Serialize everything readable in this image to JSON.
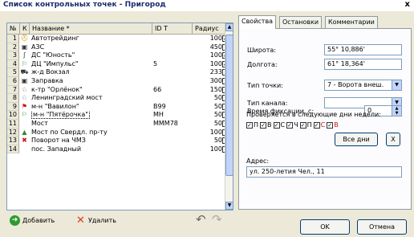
{
  "window": {
    "title": "Список контрольных точек - Пригород",
    "close_glyph": "x"
  },
  "grid": {
    "headers": [
      "№",
      "К",
      "Название *",
      "ID T",
      "Радиус"
    ],
    "rows": [
      {
        "num": "1",
        "icon": "⛑",
        "icon_color": "#cc8800",
        "name": "Автотрейдинг",
        "idt": "",
        "radius": "100",
        "checked": true
      },
      {
        "num": "2",
        "icon": "▣",
        "icon_color": "#333333",
        "name": "АЗС",
        "idt": "",
        "radius": "450",
        "checked": false
      },
      {
        "num": "3",
        "icon": "ʃ",
        "icon_color": "#333333",
        "name": "ДС \"Юность\"",
        "idt": "",
        "radius": "100",
        "checked": true
      },
      {
        "num": "4",
        "icon": "⚐",
        "icon_color": "#2e8b2e",
        "name": "ДЦ \"Импульс\"",
        "idt": "5",
        "radius": "100",
        "checked": true
      },
      {
        "num": "5",
        "icon": "⛟",
        "icon_color": "#333333",
        "name": "ж-д Вокзал",
        "idt": "",
        "radius": "233",
        "checked": false
      },
      {
        "num": "6",
        "icon": "▣",
        "icon_color": "#333333",
        "name": "Заправка",
        "idt": "",
        "radius": "300",
        "checked": false
      },
      {
        "num": "7",
        "icon": "♘",
        "icon_color": "#7a4a1e",
        "name": "к-тр \"Орлёнок\"",
        "idt": "66",
        "radius": "150",
        "checked": false
      },
      {
        "num": "8",
        "icon": "♘",
        "icon_color": "#3a5ea0",
        "name": "Ленинградский мост",
        "idt": "",
        "radius": "50",
        "checked": false
      },
      {
        "num": "9",
        "icon": "⚑",
        "icon_color": "#cc1111",
        "name": "м-н \"Вавилон\"",
        "idt": "B99",
        "radius": "50",
        "checked": false
      },
      {
        "num": "10",
        "icon": "⚐",
        "icon_color": "#2e8b2e",
        "name": "м-н \"Пятёрочка\"",
        "idt": "MH",
        "radius": "50",
        "checked": false,
        "selected": true
      },
      {
        "num": "11",
        "icon": "",
        "icon_color": "#333333",
        "name": "Мост",
        "idt": "MMM78",
        "radius": "50",
        "checked": false
      },
      {
        "num": "12",
        "icon": "▲",
        "icon_color": "#2e8b2e",
        "name": "Мост по Свердл. пр-ту",
        "idt": "",
        "radius": "100",
        "checked": false
      },
      {
        "num": "13",
        "icon": "✖",
        "icon_color": "#cc1111",
        "name": "Поворот на ЧМЗ",
        "idt": "",
        "radius": "50",
        "checked": false
      },
      {
        "num": "14",
        "icon": "",
        "icon_color": "#333333",
        "name": "пос. Западный",
        "idt": "",
        "radius": "100",
        "checked": false
      }
    ]
  },
  "toolbar": {
    "add_label": "Добавить",
    "delete_label": "Удалить"
  },
  "tabs": [
    "Свойства",
    "Остановки",
    "Комментарии"
  ],
  "properties": {
    "lat_label": "Широта:",
    "lat_value": "55° 10,886'",
    "lon_label": "Долгота:",
    "lon_value": "61° 18,364'",
    "type_label": "Тип точки:",
    "type_value": "7 - Ворота внеш.",
    "channel_label": "Тип канала:",
    "channel_value": "",
    "fix_label": "Время фиксации, с:",
    "fix_value": "0",
    "days_label": "Проверяется в следующие дни недели:",
    "days": [
      {
        "label": "П",
        "color": "#000000"
      },
      {
        "label": "В",
        "color": "#000000"
      },
      {
        "label": "С",
        "color": "#000000"
      },
      {
        "label": "Ч",
        "color": "#000000"
      },
      {
        "label": "П",
        "color": "#000000"
      },
      {
        "label": "С",
        "color": "#cc1111"
      },
      {
        "label": "В",
        "color": "#cc1111"
      }
    ],
    "all_days_label": "Все дни",
    "clear_days_label": "X",
    "address_label": "Адрес:",
    "address_value": "ул. 250-летия Чел., 11"
  },
  "footer": {
    "ok_label": "OK",
    "cancel_label": "Отмена"
  }
}
